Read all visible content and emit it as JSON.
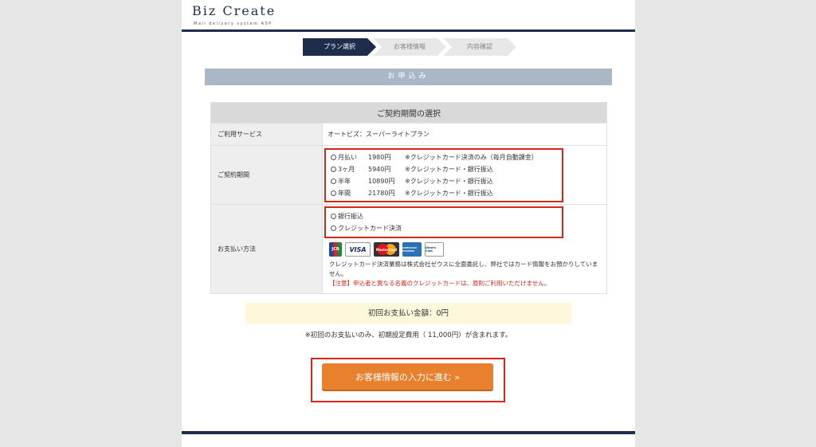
{
  "header": {
    "logo_title": "Biz Create",
    "logo_subtitle": "Mail delivery system ASP"
  },
  "steps": [
    {
      "label": "プラン選択",
      "active": true
    },
    {
      "label": "お客様情報",
      "active": false
    },
    {
      "label": "内容確認",
      "active": false
    }
  ],
  "banner": "お申込み",
  "form": {
    "section_title": "ご契約期間の選択",
    "service": {
      "label": "ご利用サービス",
      "value": "オートビズ：スーパーライトプラン"
    },
    "period": {
      "label": "ご契約期間",
      "options": [
        {
          "name": "月払い",
          "price": "1980円",
          "note": "※クレジットカード決済のみ（毎月自動課金）"
        },
        {
          "name": "3ヶ月",
          "price": "5940円",
          "note": "※クレジットカード・銀行振込"
        },
        {
          "name": "半年",
          "price": "10890円",
          "note": "※クレジットカード・銀行振込"
        },
        {
          "name": "年間",
          "price": "21780円",
          "note": "※クレジットカード・銀行振込"
        }
      ]
    },
    "payment": {
      "label": "お支払い方法",
      "options": [
        "銀行振込",
        "クレジットカード決済"
      ],
      "cards": [
        "JCB",
        "VISA",
        "MasterCard",
        "AMERICAN EXPRESS",
        "Diners Club"
      ],
      "note": "クレジットカード決済業務は株式会社ゼウスに全面委託し、弊社ではカード情報をお預かりしていません。",
      "warning_tag": "【注意】",
      "warning": "申込者と異なる名義のクレジットカードは、原則ご利用いただけません。"
    }
  },
  "total": {
    "label": "初回お支払い金額：0円",
    "note": "※初回のお支払いのみ、初期設定費用（ 11,000円）が含まれます。"
  },
  "cta": {
    "label": "お客様情報の入力に進む »"
  },
  "colors": {
    "navy": "#1f2d4d",
    "banner": "#a9b7c7",
    "cta": "#e8802e",
    "highlight": "#d9261c"
  }
}
